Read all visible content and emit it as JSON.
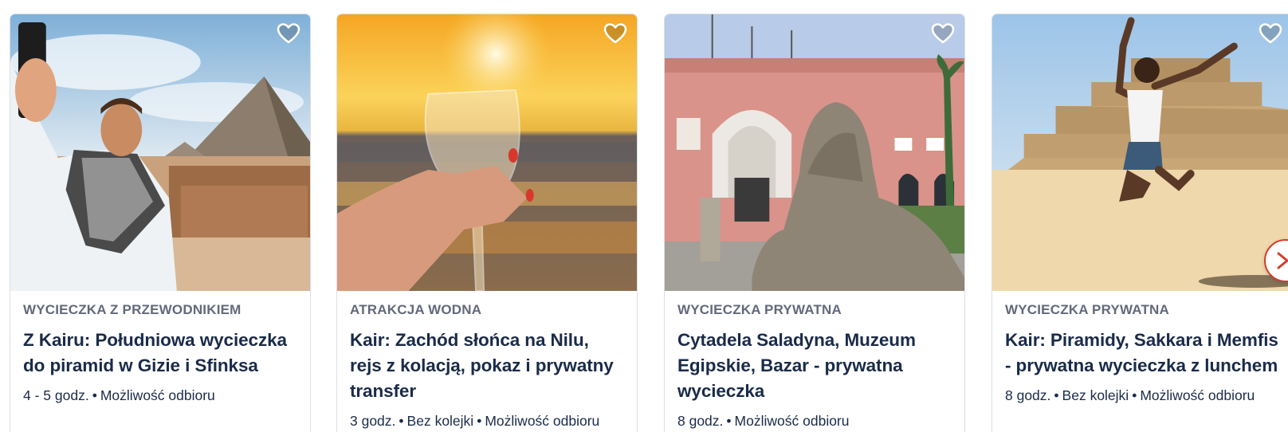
{
  "cards": [
    {
      "category": "WYCIECZKA Z PRZEWODNIKIEM",
      "title": "Z Kairu: Południowa wycieczka do piramid w Gizie i Sfinksa",
      "meta": [
        "4 - 5 godz.",
        "Możliwość odbioru"
      ],
      "image": "man-selfie-at-pyramids"
    },
    {
      "category": "ATRAKCJA WODNA",
      "title": "Kair: Zachód słońca na Nilu, rejs z kolacją, pokaz i prywatny transfer",
      "meta": [
        "3 godz.",
        "Bez kolejki",
        "Możliwość odbioru"
      ],
      "image": "wine-glass-at-sunset"
    },
    {
      "category": "WYCIECZKA PRYWATNA",
      "title": "Cytadela Saladyna, Muzeum Egipskie, Bazar - prywatna wycieczka",
      "meta": [
        "8 godz.",
        "Możliwość odbioru"
      ],
      "image": "egyptian-museum-sphinx"
    },
    {
      "category": "WYCIECZKA PRYWATNA",
      "title": "Kair: Piramidy, Sakkara i Memfis - prywatna wycieczka z lunchem",
      "meta": [
        "8 godz.",
        "Bez kolejki",
        "Możliwość odbioru"
      ],
      "image": "woman-jumping-step-pyramid"
    }
  ],
  "icons": {
    "wishlist": "heart-outline-icon",
    "next": "chevron-right-icon"
  },
  "colors": {
    "title": "#1a2b49",
    "category": "#63687a",
    "accent": "#d43d2a"
  }
}
